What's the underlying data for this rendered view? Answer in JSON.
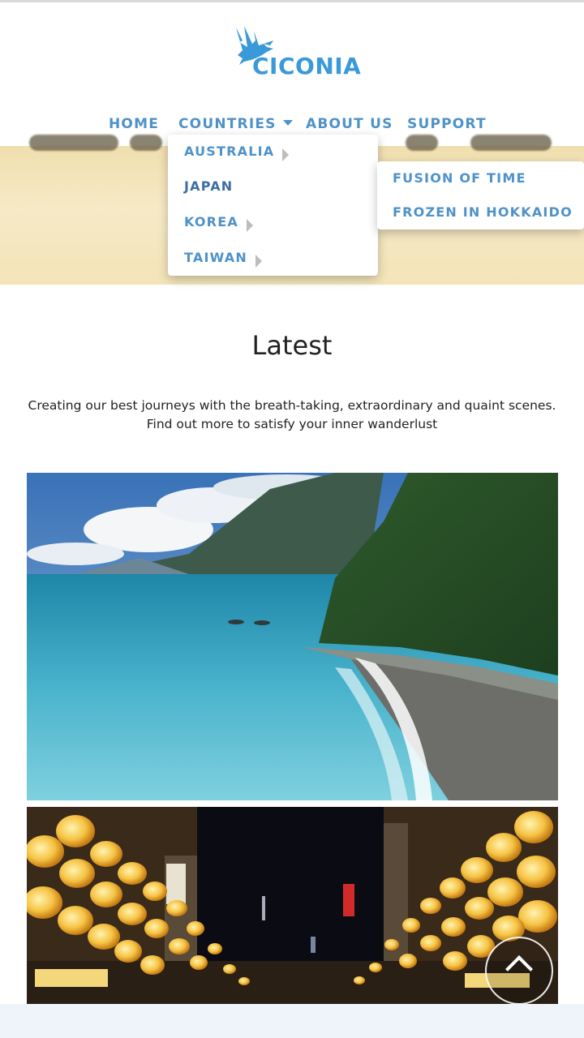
{
  "brand": {
    "name": "CICONIA",
    "logo_icon": "stork-icon",
    "color": "#3a9ad9"
  },
  "nav": {
    "items": [
      {
        "label": "HOME"
      },
      {
        "label": "COUNTRIES"
      },
      {
        "label": "ABOUT US"
      },
      {
        "label": "SUPPORT"
      }
    ],
    "color": "#4f92c8"
  },
  "countries_menu": {
    "items": [
      {
        "label": "AUSTRALIA",
        "has_submenu": true
      },
      {
        "label": "JAPAN",
        "has_submenu": false
      },
      {
        "label": "KOREA",
        "has_submenu": true
      },
      {
        "label": "TAIWAN",
        "has_submenu": true
      }
    ]
  },
  "submenu": {
    "items": [
      {
        "label": "FUSION OF TIME"
      },
      {
        "label": "FROZEN IN HOKKAIDO"
      }
    ]
  },
  "latest": {
    "title": "Latest",
    "description_line1": "Creating our best journeys with the breath-taking, extraordinary and quaint scenes.",
    "description_line2": "Find out more to satisfy your inner wanderlust"
  },
  "photos": [
    {
      "icon": "coastal-cliff-photo"
    },
    {
      "icon": "lantern-night-market-photo"
    }
  ],
  "scroll_top": {
    "icon": "chevron-up-icon"
  }
}
